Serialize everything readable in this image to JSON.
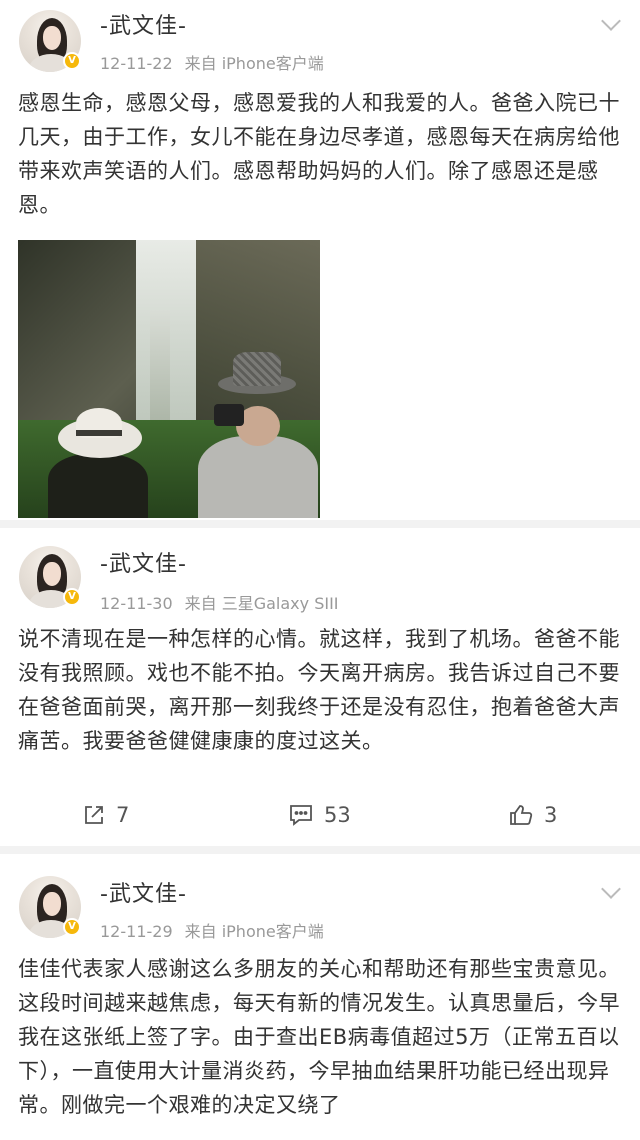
{
  "posts": [
    {
      "author": "-武文佳-",
      "date": "12-11-22",
      "source": "来自 iPhone客户端",
      "text": "感恩生命，感恩父母，感恩爱我的人和我爱的人。爸爸入院已十几天，由于工作，女儿不能在身边尽孝道，感恩每天在病房给他带来欢声笑语的人们。感恩帮助妈妈的人们。除了感恩还是感恩。",
      "verified_badge": "V"
    },
    {
      "author": "-武文佳-",
      "date": "12-11-30",
      "source": "来自 三星Galaxy SIII",
      "text": "说不清现在是一种怎样的心情。就这样，我到了机场。爸爸不能没有我照顾。戏也不能不拍。今天离开病房。我告诉过自己不要在爸爸面前哭，离开那一刻我终于还是没有忍住，抱着爸爸大声痛苦。我要爸爸健健康康的度过这关。",
      "verified_badge": "V",
      "reposts": "7",
      "comments": "53",
      "likes": "3"
    },
    {
      "author": "-武文佳-",
      "date": "12-11-29",
      "source": "来自 iPhone客户端",
      "text": "佳佳代表家人感谢这么多朋友的关心和帮助还有那些宝贵意见。这段时间越来越焦虑，每天有新的情况发生。认真思量后，今早我在这张纸上签了字。由于查出EB病毒值超过5万（正常五百以下），一直使用大计量消炎药，今早抽血结果肝功能已经出现异常。刚做完一个艰难的决定又绕了",
      "verified_badge": "V"
    }
  ],
  "colors": {
    "badge": "#f6b80b",
    "meta_text": "#999999",
    "body_text": "#333333",
    "separator": "#f2f2f2"
  },
  "icons": {
    "repost": "share-arrow-icon",
    "comment": "comment-bubble-icon",
    "like": "thumbs-up-icon",
    "menu": "chevron-down-icon"
  }
}
